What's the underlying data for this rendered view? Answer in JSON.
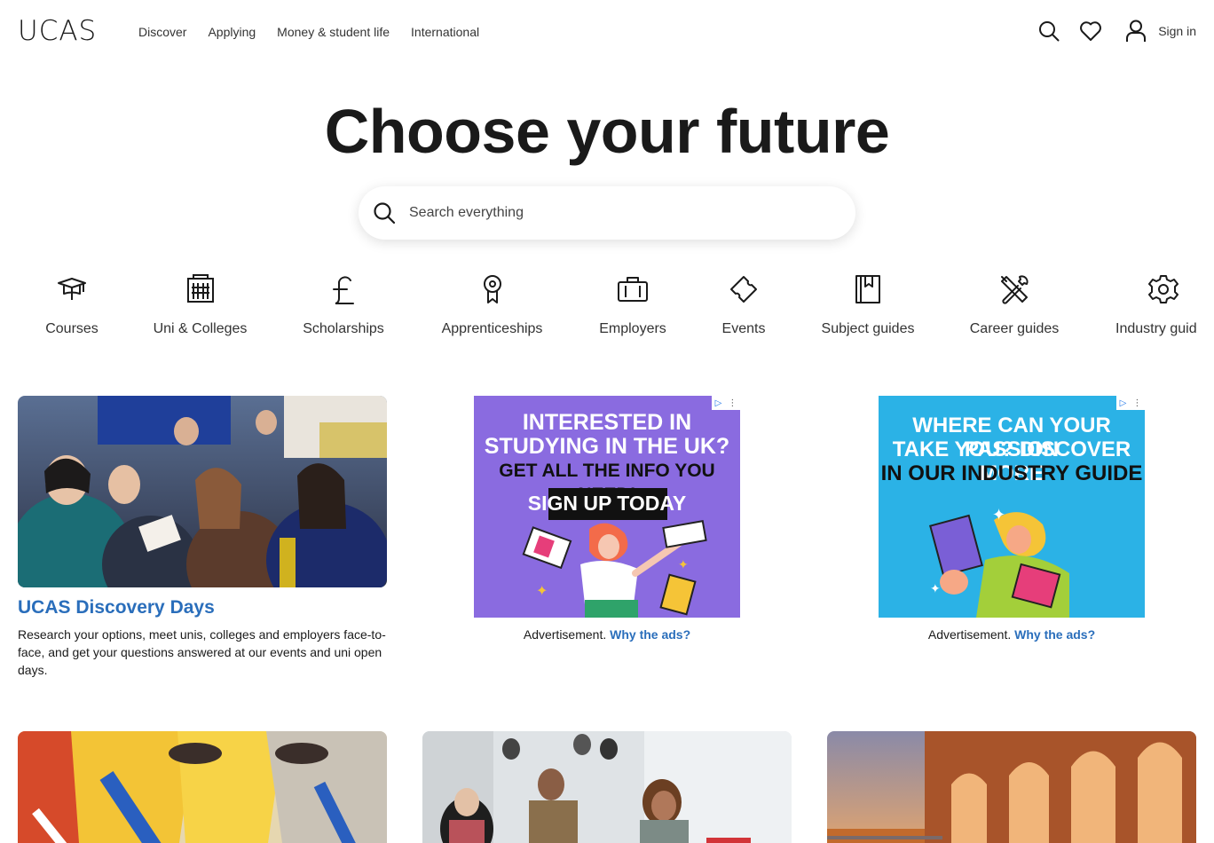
{
  "header": {
    "logo": "UCAS",
    "nav": [
      "Discover",
      "Applying",
      "Money & student life",
      "International"
    ],
    "sign_in": "Sign in"
  },
  "hero": {
    "title": "Choose your future",
    "search_placeholder": "Search everything"
  },
  "categories": [
    {
      "label": "Courses",
      "icon": "graduation-cap-icon"
    },
    {
      "label": "Uni & Colleges",
      "icon": "building-icon"
    },
    {
      "label": "Scholarships",
      "icon": "pound-icon"
    },
    {
      "label": "Apprenticeships",
      "icon": "award-rosette-icon"
    },
    {
      "label": "Employers",
      "icon": "briefcase-icon"
    },
    {
      "label": "Events",
      "icon": "ticket-icon"
    },
    {
      "label": "Subject guides",
      "icon": "bookmark-book-icon"
    },
    {
      "label": "Career guides",
      "icon": "tools-icon"
    },
    {
      "label": "Industry guid",
      "icon": "gear-icon"
    }
  ],
  "feature_card": {
    "title": "UCAS Discovery Days",
    "description": "Research your options, meet unis, colleges and employers face-to-face, and get your questions answered at our events and uni open days."
  },
  "ads": [
    {
      "lines": [
        "INTERESTED IN",
        "STUDYING IN THE UK?",
        "GET ALL THE INFO YOU NEED!"
      ],
      "cta": "SIGN UP TODAY",
      "bg": "#8a6be0",
      "caption": "Advertisement.",
      "link": "Why the ads?"
    },
    {
      "lines": [
        "WHERE CAN YOUR PASSION",
        "TAKE YOU? DISCOVER MORE",
        "IN OUR INDUSTRY GUIDE"
      ],
      "bg": "#2bb2e6",
      "caption": "Advertisement.",
      "link": "Why the ads?"
    }
  ],
  "colors": {
    "accent": "#2a6ebb",
    "text": "#1a1a1a"
  }
}
